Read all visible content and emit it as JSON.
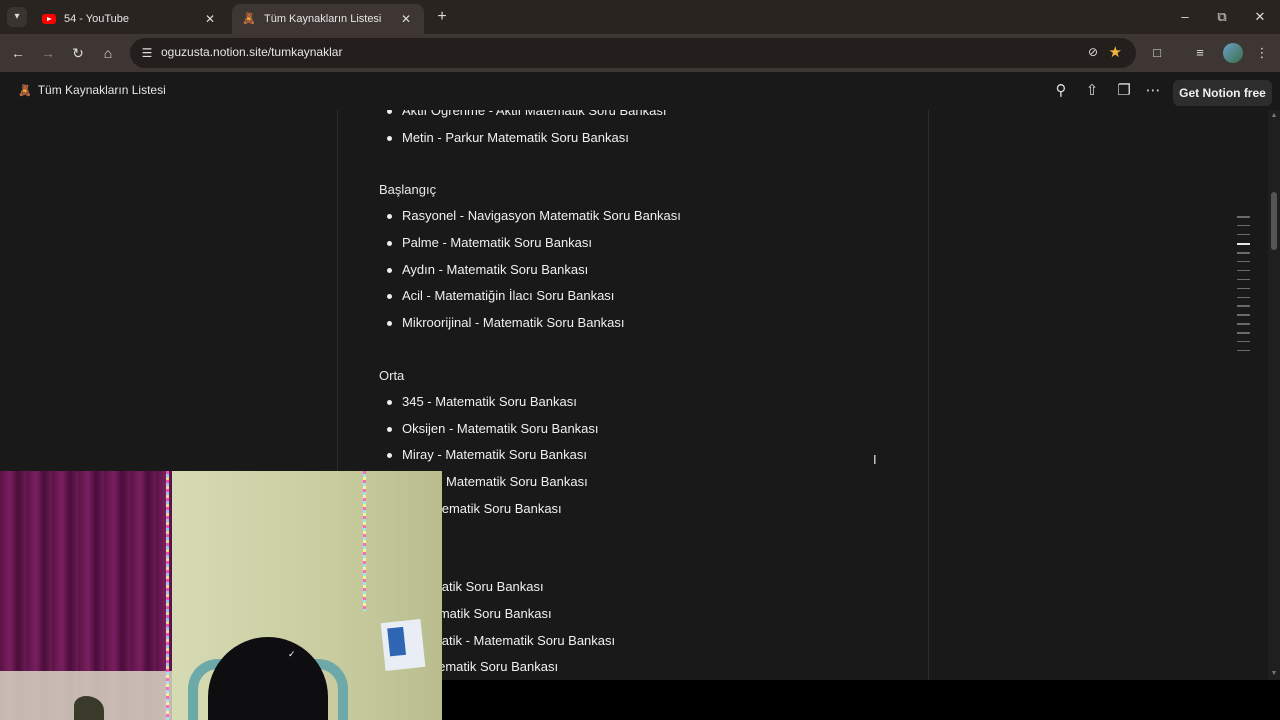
{
  "browser": {
    "tabs": [
      {
        "title": "54 - YouTube",
        "favicon": "youtube-icon",
        "active": false
      },
      {
        "title": "Tüm Kaynakların Listesi",
        "favicon": "notion-page-icon",
        "active": true
      }
    ],
    "url": "oguzusta.notion.site/tumkaynaklar",
    "accent": "#f1b53d"
  },
  "notion": {
    "page_title": "Tüm Kaynakların Listesi",
    "get_free_label": "Get Notion free"
  },
  "doc": {
    "top_items": [
      "Aktif Öğrenme - Aktif Matematik Soru Bankası",
      "Metin - Parkur Matematik Soru Bankası"
    ],
    "sections": [
      {
        "title": "Başlangıç",
        "items": [
          "Rasyonel - Navigasyon Matematik Soru Bankası",
          "Palme - Matematik Soru Bankası",
          "Aydın - Matematik Soru Bankası",
          "Acil - Matematiğin İlacı Soru Bankası",
          "Mikroorijinal - Matematik Soru Bankası"
        ]
      },
      {
        "title": "Orta",
        "items": [
          "345 - Matematik Soru Bankası",
          "Oksijen - Matematik Soru Bankası",
          "Miray - Matematik Soru Bankası",
          "armal - Matematik Soru Bankası",
          "k - Matematik Soru Bankası"
        ]
      },
      {
        "title": "",
        "items": [
          "Matematik Soru Bankası",
          "- Matematik Soru Bankası",
          "Matematik - Matematik Soru Bankası",
          "l - Matematik Soru Bankası"
        ]
      }
    ]
  }
}
